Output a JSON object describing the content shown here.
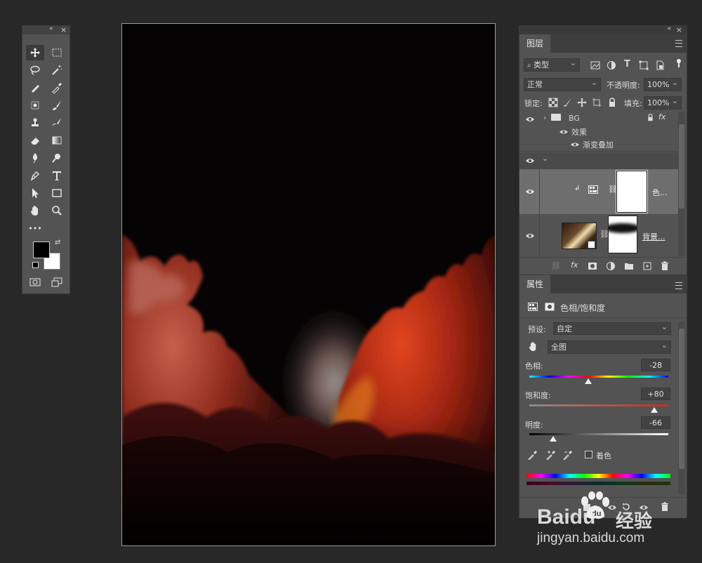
{
  "toolbox": {
    "collapse_glyph": "«",
    "close_glyph": "×",
    "more_glyph": "•••",
    "foreground_color": "#000000",
    "background_color": "#ffffff"
  },
  "layers_panel": {
    "tab_label": "图层",
    "collapse_glyph": "«",
    "close_glyph": "×",
    "filter_label": "类型",
    "filter_icon": "search-icon",
    "blend_mode": "正常",
    "opacity_label": "不透明度:",
    "opacity_value": "100%",
    "lock_label": "锁定:",
    "fill_label": "填充:",
    "fill_value": "100%",
    "text_filter_glyph": "T",
    "layers": [
      {
        "name": "BG",
        "type": "group",
        "expanded": false,
        "locked": true,
        "fx": "fx"
      },
      {
        "name": "效果",
        "type": "effects-header"
      },
      {
        "name": "渐变叠加",
        "type": "effect"
      },
      {
        "name": "",
        "type": "group",
        "expanded": true
      },
      {
        "name": "色...",
        "type": "adjustment",
        "selected": true
      },
      {
        "name": "背景...",
        "type": "smart-object"
      }
    ],
    "footer_fx": "fx"
  },
  "properties_panel": {
    "tab_label": "属性",
    "adjustment_title": "色相/饱和度",
    "preset_label": "预设:",
    "preset_value": "自定",
    "channel_value": "全图",
    "hue_label": "色相:",
    "hue_value": "-28",
    "hue_level": -28,
    "saturation_label": "饱和度:",
    "saturation_value": "+80",
    "saturation_level": 80,
    "lightness_label": "明度:",
    "lightness_value": "-66",
    "lightness_level": -66,
    "colorize_label": "着色",
    "colorize_checked": false
  },
  "watermark": {
    "brand": "Baidu",
    "brand_cn": "经验",
    "url": "jingyan.baidu.com"
  },
  "colors": {
    "panel_bg": "#535353",
    "app_bg": "#282828",
    "cloud_red": "#b8301c",
    "cloud_glow": "#8a7a75"
  }
}
